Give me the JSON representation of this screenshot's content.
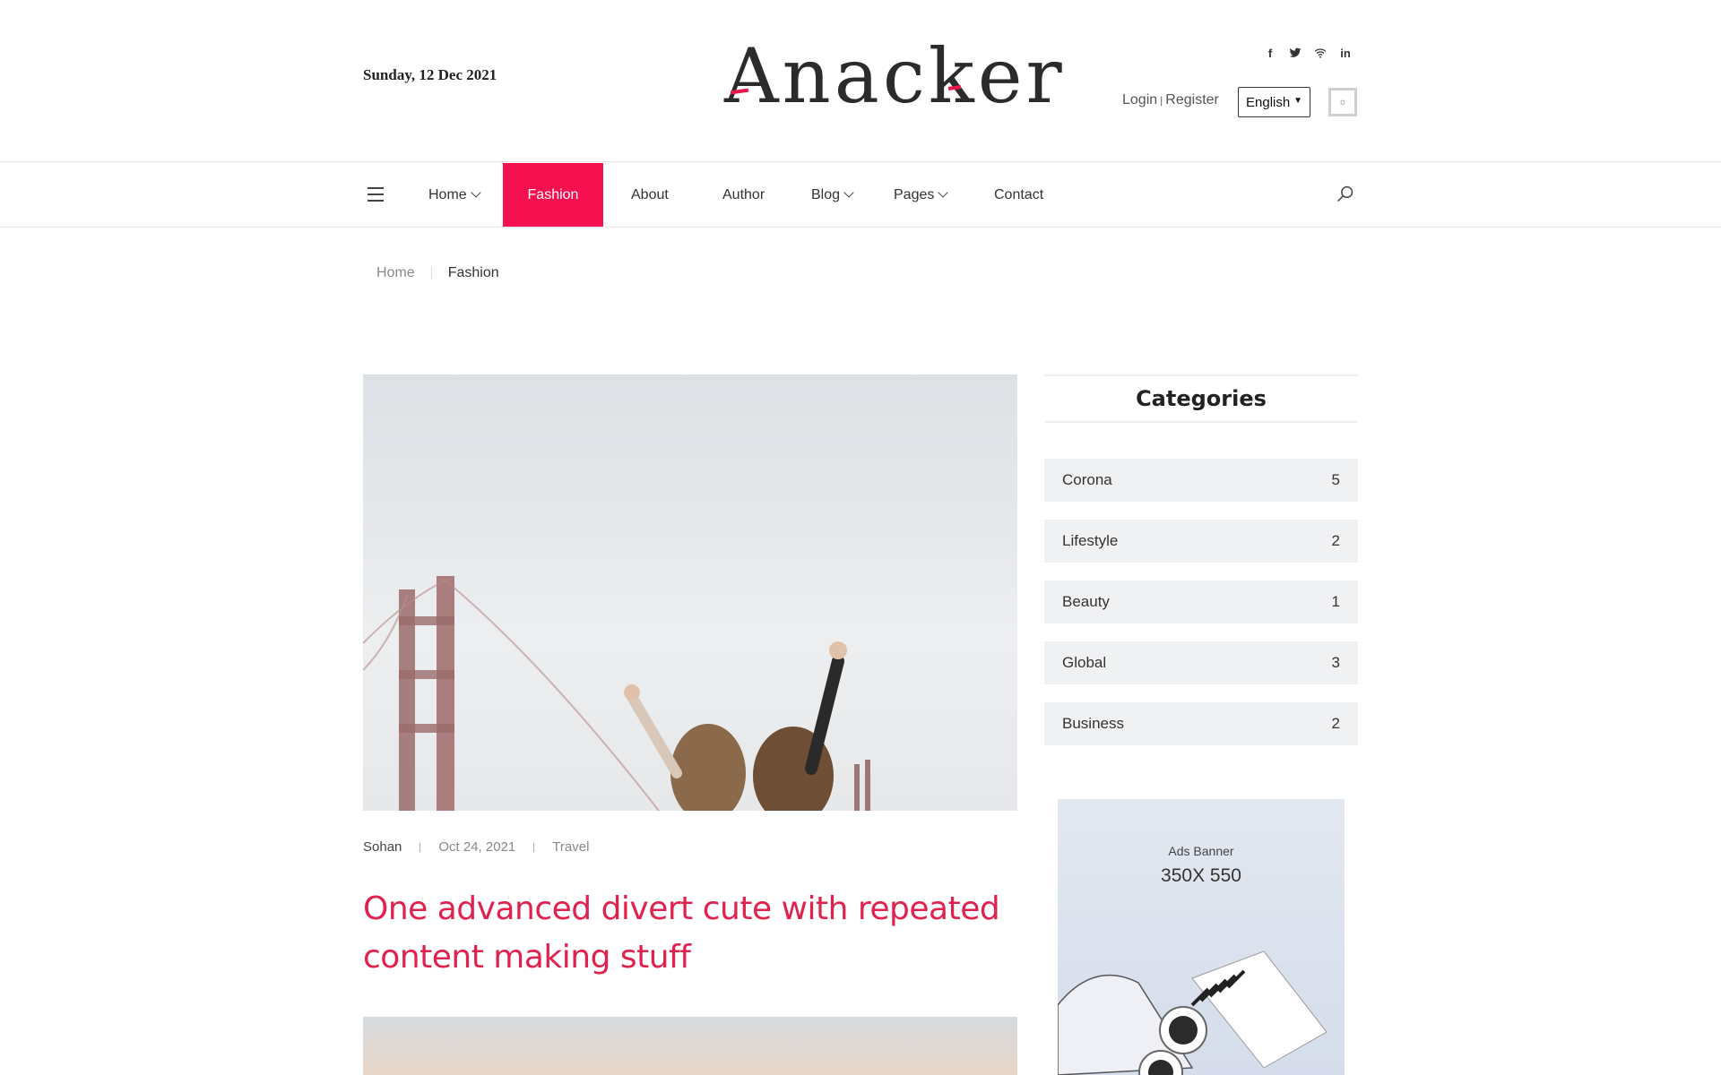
{
  "header": {
    "date": "Sunday, 12 Dec 2021",
    "logo": "Anacker",
    "social": [
      {
        "icon": "facebook-icon",
        "glyph": "f"
      },
      {
        "icon": "twitter-icon",
        "glyph": "t"
      },
      {
        "icon": "wifi-icon",
        "glyph": "≋"
      },
      {
        "icon": "linkedin-icon",
        "glyph": "in"
      }
    ],
    "login": "Login",
    "separator": "|",
    "register": "Register",
    "language": "English",
    "theme_icon": "sun-icon"
  },
  "nav": {
    "items": [
      {
        "label": "Home",
        "dropdown": true
      },
      {
        "label": "Fashion",
        "active": true
      },
      {
        "label": "About"
      },
      {
        "label": "Author"
      },
      {
        "label": "Blog",
        "dropdown": true
      },
      {
        "label": "Pages",
        "dropdown": true
      },
      {
        "label": "Contact"
      }
    ]
  },
  "breadcrumb": {
    "home": "Home",
    "current": "Fashion"
  },
  "post": {
    "author": "Sohan",
    "date": "Oct 24, 2021",
    "category": "Travel",
    "title": "One advanced divert cute with repeated content making stuff"
  },
  "sidebar": {
    "categories_title": "Categories",
    "categories": [
      {
        "name": "Corona",
        "count": "5"
      },
      {
        "name": "Lifestyle",
        "count": "2"
      },
      {
        "name": "Beauty",
        "count": "1"
      },
      {
        "name": "Global",
        "count": "3"
      },
      {
        "name": "Business",
        "count": "2"
      }
    ],
    "ad_label": "Ads Banner",
    "ad_size": "350X 550"
  },
  "colors": {
    "accent": "#f5104f",
    "title": "#e0224f",
    "category_bg": "#f0f1f3"
  }
}
